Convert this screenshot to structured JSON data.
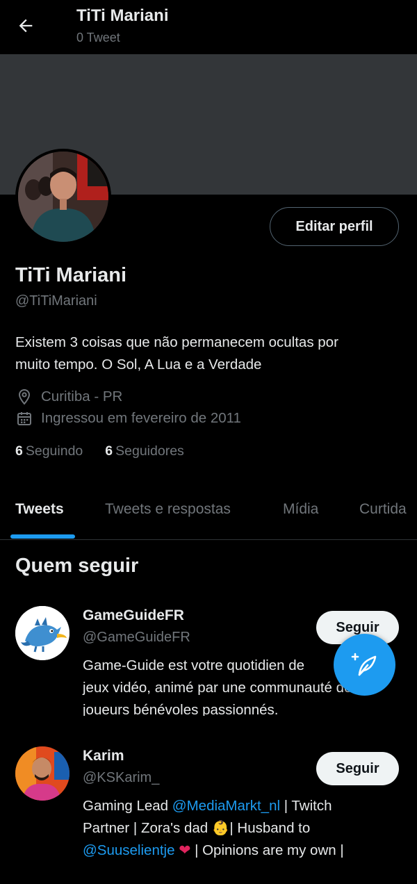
{
  "header": {
    "title": "TiTi Mariani",
    "tweet_count": "0 Tweet"
  },
  "profile": {
    "name": "TiTi Mariani",
    "handle": "@TiTiMariani",
    "edit_label": "Editar perfil",
    "bio_line1": "Existem 3 coisas que não permanecem ocultas por",
    "bio_line2": "muito tempo. O Sol, A Lua e a Verdade",
    "location": "Curitiba - PR",
    "joined": "Ingressou em fevereiro de 2011",
    "following_count": "6",
    "following_label": "Seguindo",
    "followers_count": "6",
    "followers_label": "Seguidores"
  },
  "tabs": [
    {
      "label": "Tweets",
      "active": true
    },
    {
      "label": "Tweets e respostas",
      "active": false
    },
    {
      "label": "Mídia",
      "active": false
    },
    {
      "label": "Curtida",
      "active": false
    }
  ],
  "who_to_follow": {
    "title": "Quem seguir",
    "items": [
      {
        "name": "GameGuideFR",
        "handle": "@GameGuideFR",
        "follow_label": "Seguir",
        "bio_line1": "Game-Guide est votre quotidien de",
        "bio_line2": "jeux vidéo, animé par une communauté de",
        "bio_line3": "joueurs bénévoles passionnés."
      },
      {
        "name": "Karim",
        "handle": "@KSKarim_",
        "follow_label": "Seguir",
        "bio_l1_a": "Gaming Lead ",
        "bio_l1_mention": "@MediaMarkt_nl",
        "bio_l1_b": " | Twitch",
        "bio_l2_a": "Partner | Zora's dad ",
        "bio_l2_emoji": "👶",
        "bio_l2_b": "| Husband to",
        "bio_l3_mention": "@Suuselientje",
        "bio_l3_heart": "❤",
        "bio_l3_b": " | Opinions are my own |"
      }
    ]
  },
  "colors": {
    "accent": "#1d9bf0",
    "background": "#000000",
    "secondary_text": "#71767b"
  },
  "icons": {
    "back": "arrow-left-icon",
    "location": "location-pin-icon",
    "calendar": "calendar-icon",
    "compose": "compose-tweet-icon"
  }
}
